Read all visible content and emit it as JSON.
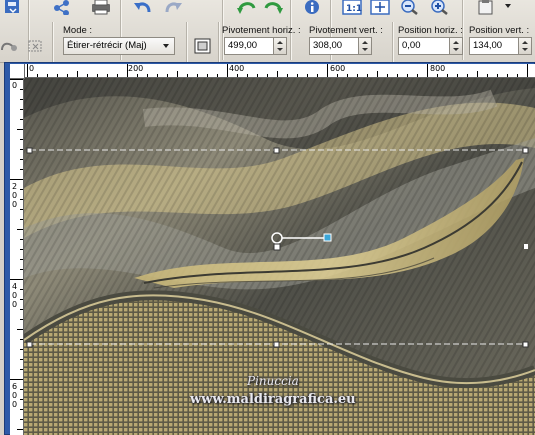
{
  "toolbar": {
    "mode_label": "Mode :",
    "mode_value": "Étirer-rétrécir (Maj)",
    "pivot_h_label": "Pivotement horiz. :",
    "pivot_h_value": "499,00",
    "pivot_v_label": "Pivotement vert. :",
    "pivot_v_value": "308,00",
    "pos_h_label": "Position horiz. :",
    "pos_h_value": "0,00",
    "pos_v_label": "Position vert. :",
    "pos_v_value": "134,00"
  },
  "ruler": {
    "top_ticks": [
      "0",
      "200",
      "400",
      "600",
      "800"
    ],
    "left_ticks": [
      "0",
      "200",
      "400",
      "600"
    ]
  },
  "canvas": {
    "watermark_name": "Pinuccia",
    "watermark_site": "www.maldiragrafica.eu"
  },
  "colors": {
    "frame": "#2d5aa8",
    "gold": "#c9b77a",
    "gray": "#5a5a55",
    "handle_line": "#e8e8e8"
  }
}
